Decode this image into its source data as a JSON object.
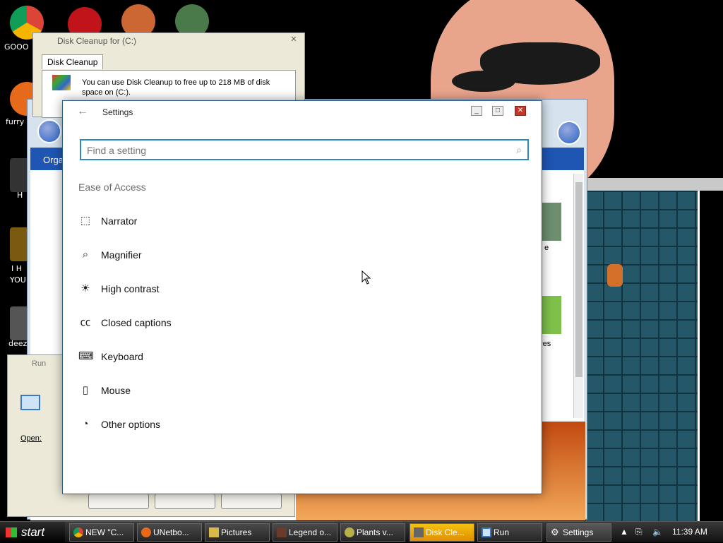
{
  "desktop": {
    "icons": [
      {
        "label": "GOOO",
        "icon": "chrome-icon"
      },
      {
        "label": "furry",
        "icon": "firefox-icon"
      },
      {
        "label": "H",
        "icon": "h-app-icon"
      },
      {
        "label": "I H",
        "icon": "app-icon"
      },
      {
        "label": "YOU",
        "icon": "app-icon"
      },
      {
        "label": "deez",
        "icon": "folder-icon"
      }
    ]
  },
  "disk_cleanup": {
    "title": "Disk Cleanup for (C:)",
    "tab": "Disk Cleanup",
    "message": "You can use Disk Cleanup to free up to 218 MB of disk space on  (C:)."
  },
  "explorer": {
    "toolbar_label": "Orga",
    "thumb_labels": [
      "e",
      "res"
    ]
  },
  "run": {
    "title": "Run",
    "open_label": "Open:"
  },
  "settings": {
    "title": "Settings",
    "search_placeholder": "Find a setting",
    "section": "Ease of Access",
    "items": [
      {
        "label": "Narrator",
        "icon": "narrator-icon",
        "glyph": "⬚"
      },
      {
        "label": "Magnifier",
        "icon": "magnifier-icon",
        "glyph": "⌕"
      },
      {
        "label": "High contrast",
        "icon": "brightness-icon",
        "glyph": "☀"
      },
      {
        "label": "Closed captions",
        "icon": "closed-captions-icon",
        "glyph": "㏄"
      },
      {
        "label": "Keyboard",
        "icon": "keyboard-icon",
        "glyph": "⌨"
      },
      {
        "label": "Mouse",
        "icon": "mouse-icon",
        "glyph": "▯"
      },
      {
        "label": "Other options",
        "icon": "other-options-icon",
        "glyph": "◔"
      }
    ]
  },
  "taskbar": {
    "start_label": "start",
    "tasks": [
      {
        "label": "NEW \"C...",
        "icon": "chrome-icon"
      },
      {
        "label": "UNetbo...",
        "icon": "unetbootin-icon"
      },
      {
        "label": "Pictures",
        "icon": "folder-icon"
      },
      {
        "label": "Legend o...",
        "icon": "game-icon"
      },
      {
        "label": "Plants v...",
        "icon": "plants-icon"
      },
      {
        "label": "Disk Cle...",
        "icon": "disk-cleanup-icon"
      },
      {
        "label": "Run",
        "icon": "run-icon"
      },
      {
        "label": "Settings",
        "icon": "settings-gear-icon"
      }
    ],
    "clock": "11:39 AM"
  },
  "colors": {
    "accent": "#2b88c4",
    "taskbar_active": "#f5c211",
    "explorer_bar": "#1f56b4"
  }
}
